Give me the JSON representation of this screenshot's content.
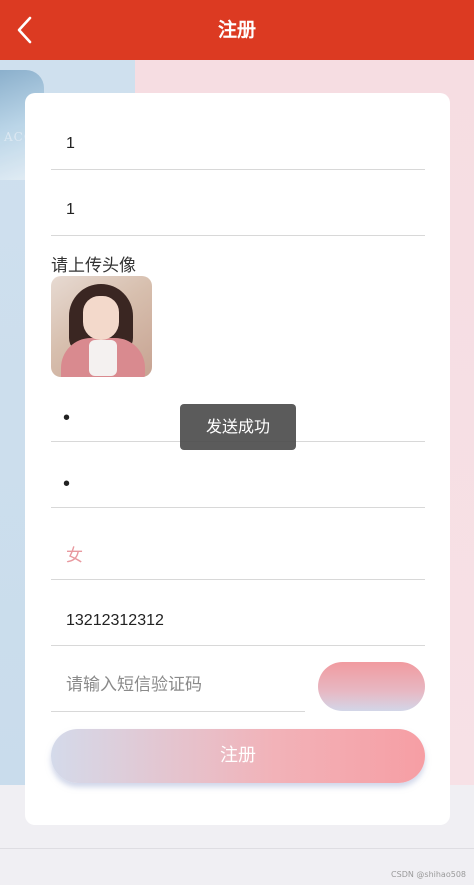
{
  "header": {
    "title": "注册",
    "back_icon": "chevron-left-icon"
  },
  "background": {
    "bottle_text": "ACQU"
  },
  "form": {
    "field1_value": "1",
    "field2_value": "1",
    "upload_label": "请上传头像",
    "password_value": "•",
    "confirm_password_value": "•",
    "gender_value": "女",
    "phone_value": "13212312312",
    "sms_placeholder": "请输入短信验证码",
    "submit_label": "注册"
  },
  "toast": {
    "message": "发送成功"
  },
  "watermark": "CSDN @shihao508",
  "colors": {
    "header": "#dc3a22",
    "gender_text": "#e8999f",
    "submit_gradient_end": "#f69ea4"
  }
}
